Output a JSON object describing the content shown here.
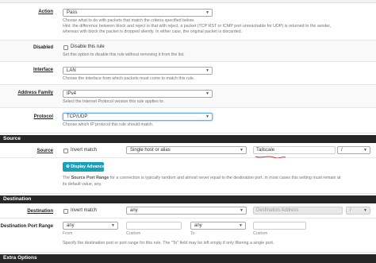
{
  "action": {
    "label": "Action",
    "value": "Pass",
    "help_1": "Choose what to do with packets that match the criteria specified below.",
    "help_2": "Hint: the difference between block and reject is that with reject, a packet (TCP RST or ICMP port unreachable for UDP) is returned to the sender,",
    "help_3": "whereas with block the packet is dropped silently. In either case, the original packet is discarded."
  },
  "disabled": {
    "label": "Disabled",
    "checkbox_label": "Disable this rule",
    "help": "Set this option to disable this rule without removing it from the list."
  },
  "interface": {
    "label": "Interface",
    "value": "LAN",
    "help": "Choose the interface from which packets must come to match this rule."
  },
  "address_family": {
    "label": "Address Family",
    "value": "IPv4",
    "help": "Select the Internet Protocol version this rule applies to."
  },
  "protocol": {
    "label": "Protocol",
    "value": "TCP/UDP",
    "help": "Choose which IP protocol this rule should match."
  },
  "source_section": {
    "title": "Source",
    "label": "Source",
    "invert_label": "Invert match",
    "type_value": "Single host or alias",
    "address_value": "Tailscale",
    "mask_value": "/",
    "display_advanced": "Display Advanced",
    "help_pre": "The ",
    "help_bold": "Source Port Range",
    "help_post": " for a connection is typically random and almost never equal to the destination port. In most cases this setting must remain at",
    "help_2": "its default value, any."
  },
  "destination_section": {
    "title": "Destination",
    "label": "Destination",
    "invert_label": "Invert match",
    "type_value": "any",
    "address_placeholder": "Destination Address",
    "mask_value": "/",
    "port_label": "Destination Port Range",
    "from_value": "any",
    "from_custom_value": "",
    "to_value": "any",
    "to_custom_value": "",
    "from_label": "From",
    "custom_label_1": "Custom",
    "to_label": "To",
    "custom_label_2": "Custom",
    "help": "Specify the destination port or port range for this rule. The \"To\" field may be left empty if only filtering a single port."
  },
  "extra_section": {
    "title": "Extra Options"
  },
  "colors": {
    "section_bg": "#262626",
    "button_bg": "#17a2b8",
    "annotation_red": "#e03030"
  }
}
